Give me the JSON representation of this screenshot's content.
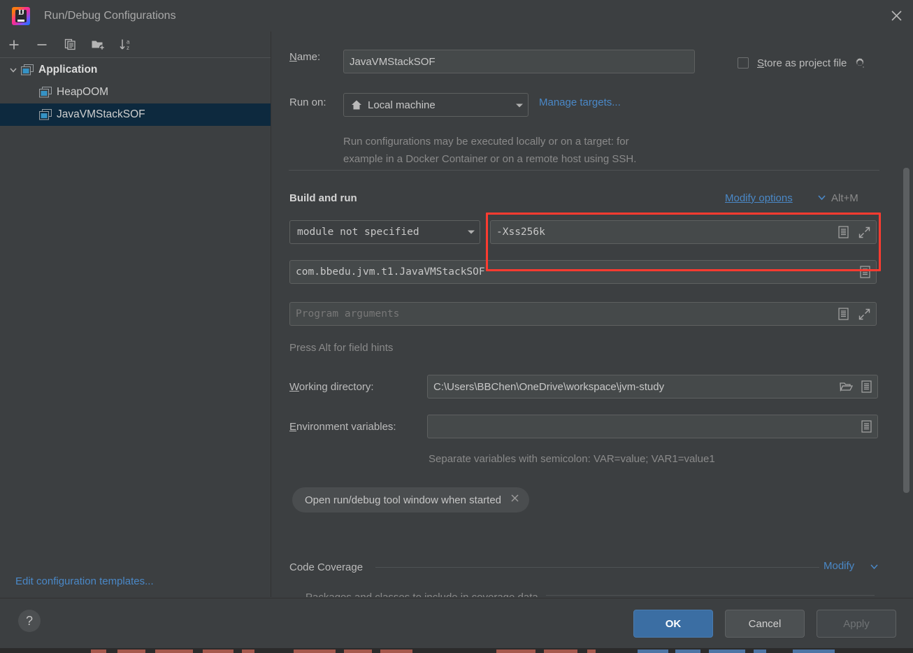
{
  "window": {
    "title": "Run/Debug Configurations",
    "logo_text": "IJ",
    "close_icon": "close-icon"
  },
  "toolbar": {
    "buttons": [
      {
        "name": "add-configuration-button",
        "icon": "plus-icon",
        "tooltip": "Add New Configuration"
      },
      {
        "name": "remove-configuration-button",
        "icon": "minus-icon",
        "tooltip": "Remove Configuration"
      },
      {
        "name": "copy-configuration-button",
        "icon": "copy-icon",
        "tooltip": "Copy Configuration"
      },
      {
        "name": "move-into-folder-button",
        "icon": "folder-add-icon",
        "tooltip": "Create New Folder"
      },
      {
        "name": "sort-configurations-button",
        "icon": "sort-az-icon",
        "tooltip": "Sort Configurations"
      }
    ]
  },
  "sidebar": {
    "tree": [
      {
        "label": "Application",
        "type": "group",
        "expanded": true,
        "icon": "application-icon"
      },
      {
        "label": "HeapOOM",
        "type": "child",
        "selected": false,
        "icon": "application-icon"
      },
      {
        "label": "JavaVMStackSOF",
        "type": "child",
        "selected": true,
        "icon": "application-icon"
      }
    ],
    "edit_templates_link": "Edit configuration templates..."
  },
  "form": {
    "name_label": "Name:",
    "name_label_mnemonic": "N",
    "name_value": "JavaVMStackSOF",
    "store_as_project_file_label": "Store as project file",
    "store_as_project_file_mnemonic": "S",
    "store_as_project_file_checked": false,
    "store_gear_icon": "gear-icon",
    "run_on_label": "Run on:",
    "run_on_value": "Local machine",
    "run_on_icon": "home-icon",
    "manage_targets_link": "Manage targets...",
    "run_on_description_line1": "Run configurations may be executed locally or on a target: for",
    "run_on_description_line2": "example in a Docker Container or on a remote host using SSH.",
    "build_and_run_title": "Build and run",
    "modify_options_link": "Modify options",
    "modify_options_shortcut": "Alt+M",
    "modify_options_mnemonic": "M",
    "module_value": "module not specified",
    "vm_options_value": "-Xss256k",
    "main_class_value": "com.bbedu.jvm.t1.JavaVMStackSOF",
    "program_arguments_placeholder": "Program arguments",
    "field_hints_text": "Press Alt for field hints",
    "working_directory_label": "Working directory:",
    "working_directory_mnemonic": "W",
    "working_directory_value": "C:\\Users\\BBChen\\OneDrive\\workspace\\jvm-study",
    "environment_variables_label": "Environment variables:",
    "environment_variables_mnemonic": "E",
    "environment_variables_value": "",
    "environment_variables_hint": "Separate variables with semicolon: VAR=value; VAR1=value1",
    "open_tool_window_chip": "Open run/debug tool window when started",
    "chip_close_icon": "close-icon",
    "code_coverage_title": "Code Coverage",
    "code_coverage_modify_link": "Modify",
    "coverage_packages_title": "Packages and classes to include in coverage data",
    "icons": {
      "macro": "macro-list-icon",
      "expand": "expand-icon",
      "browse_folder": "folder-open-icon"
    }
  },
  "annotation": {
    "highlight_color": "#ff3b30",
    "highlight_target": "vm-options-field"
  },
  "footer": {
    "help_label": "?",
    "ok_label": "OK",
    "cancel_label": "Cancel",
    "apply_label": "Apply",
    "apply_enabled": false
  },
  "colors": {
    "background": "#3c3f41",
    "field_background": "#45494a",
    "selection": "#0d293e",
    "link": "#4a88c7",
    "primary_button": "#3b6ea3",
    "text": "#bbbbbb",
    "muted_text": "#8a8a8a"
  }
}
